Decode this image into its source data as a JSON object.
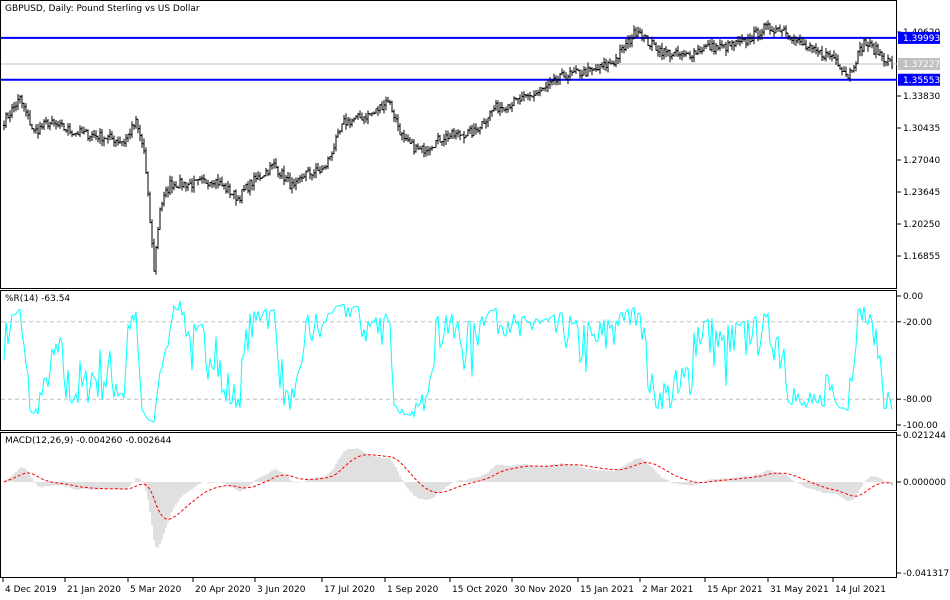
{
  "header": {
    "title": "GBPUSD, Daily:  Pound Sterling vs US Dollar"
  },
  "chart_data": [
    {
      "type": "ohlc",
      "name": "price",
      "title": "GBPUSD, Daily:  Pound Sterling vs US Dollar",
      "y_ticks": [
        "1.40620",
        "1.33830",
        "1.30435",
        "1.27040",
        "1.23645",
        "1.20250",
        "1.16855"
      ],
      "ylim": [
        1.135,
        1.44
      ],
      "levels": [
        {
          "label": "1.39993",
          "value": 1.39993,
          "color": "#0000ff"
        },
        {
          "label": "1.35553",
          "value": 1.35553,
          "color": "#0000ff"
        }
      ],
      "current": {
        "label": "1.37227",
        "value": 1.37227,
        "color": "#c0c0c0"
      },
      "keypoints_bar_price": [
        [
          0,
          1.312
        ],
        [
          8,
          1.335
        ],
        [
          15,
          1.3
        ],
        [
          22,
          1.31
        ],
        [
          35,
          1.3
        ],
        [
          50,
          1.295
        ],
        [
          60,
          1.29
        ],
        [
          66,
          1.31
        ],
        [
          70,
          1.28
        ],
        [
          75,
          1.155
        ],
        [
          78,
          1.22
        ],
        [
          83,
          1.245
        ],
        [
          95,
          1.245
        ],
        [
          105,
          1.25
        ],
        [
          117,
          1.23
        ],
        [
          123,
          1.245
        ],
        [
          135,
          1.265
        ],
        [
          145,
          1.24
        ],
        [
          150,
          1.255
        ],
        [
          160,
          1.26
        ],
        [
          170,
          1.31
        ],
        [
          185,
          1.32
        ],
        [
          192,
          1.335
        ],
        [
          200,
          1.29
        ],
        [
          208,
          1.28
        ],
        [
          220,
          1.295
        ],
        [
          235,
          1.3
        ],
        [
          245,
          1.325
        ],
        [
          260,
          1.335
        ],
        [
          270,
          1.345
        ],
        [
          280,
          1.36
        ],
        [
          295,
          1.365
        ],
        [
          305,
          1.375
        ],
        [
          312,
          1.395
        ],
        [
          317,
          1.41
        ],
        [
          322,
          1.395
        ],
        [
          330,
          1.385
        ],
        [
          340,
          1.38
        ],
        [
          350,
          1.39
        ],
        [
          360,
          1.39
        ],
        [
          370,
          1.395
        ],
        [
          380,
          1.41
        ],
        [
          390,
          1.41
        ],
        [
          397,
          1.395
        ],
        [
          405,
          1.385
        ],
        [
          415,
          1.38
        ],
        [
          422,
          1.36
        ],
        [
          430,
          1.395
        ],
        [
          437,
          1.385
        ],
        [
          444,
          1.372
        ]
      ],
      "x_labels": [
        "4 Dec 2019",
        "21 Jan 2020",
        "5 Mar 2020",
        "20 Apr 2020",
        "3 Jun 2020",
        "17 Jul 2020",
        "1 Sep 2020",
        "15 Oct 2020",
        "30 Nov 2020",
        "15 Jan 2021",
        "2 Mar 2021",
        "15 Apr 2021",
        "31 May 2021",
        "14 Jul 2021"
      ]
    },
    {
      "type": "line",
      "name": "wpr",
      "label": "%R(14) -63.54",
      "y_ticks": [
        "0.00",
        "-20.00",
        "-80.00",
        "-100.00"
      ],
      "ylim": [
        -100,
        0
      ],
      "levels": [
        -20,
        -80
      ],
      "color": "#00ffff"
    },
    {
      "type": "bar",
      "name": "macd",
      "label": "MACD(12,26,9) -0.004260 -0.002644",
      "y_ticks": [
        "0.021244",
        "0.000000",
        "-0.041317"
      ],
      "ylim": [
        -0.041317,
        0.021244
      ],
      "hist_color": "#c0c0c0",
      "signal_color": "#ff0000"
    }
  ]
}
